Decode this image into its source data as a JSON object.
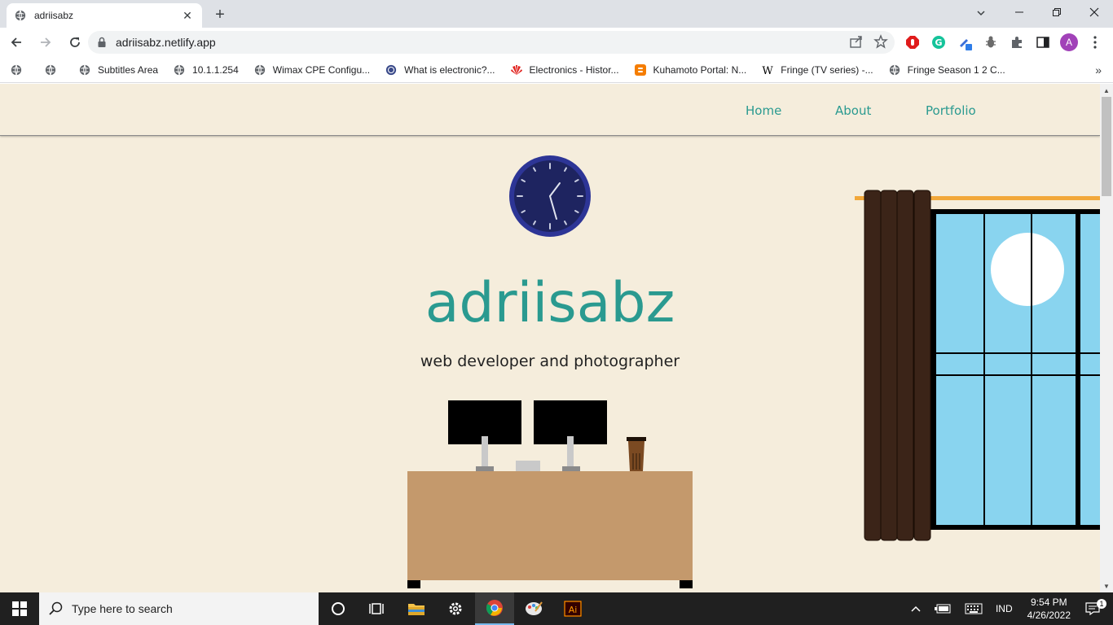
{
  "browser": {
    "tab_title": "adriisabz",
    "url": "adriisabz.netlify.app",
    "profile_initial": "A",
    "bookmarks": [
      {
        "label": ""
      },
      {
        "label": ""
      },
      {
        "label": "Subtitles Area"
      },
      {
        "label": "10.1.1.254"
      },
      {
        "label": "Wimax CPE Configu..."
      },
      {
        "label": "What is electronic?..."
      },
      {
        "label": "Electronics - Histor..."
      },
      {
        "label": "Kuhamoto Portal: N..."
      },
      {
        "label": "Fringe (TV series) -..."
      },
      {
        "label": "Fringe Season 1 2 C..."
      }
    ]
  },
  "site": {
    "nav": {
      "home": "Home",
      "about": "About",
      "portfolio": "Portfolio"
    },
    "title": "adriisabz",
    "subtitle": "web developer and photographer",
    "colors": {
      "background": "#f5eddc",
      "accent": "#2a9a90",
      "desk": "#c4996c",
      "sky": "#89d4ef",
      "curtain": "#3b2418",
      "clock": "#1e2460"
    }
  },
  "taskbar": {
    "search_placeholder": "Type here to search",
    "language": "IND",
    "time": "9:54 PM",
    "date": "4/26/2022",
    "notification_count": "1"
  }
}
